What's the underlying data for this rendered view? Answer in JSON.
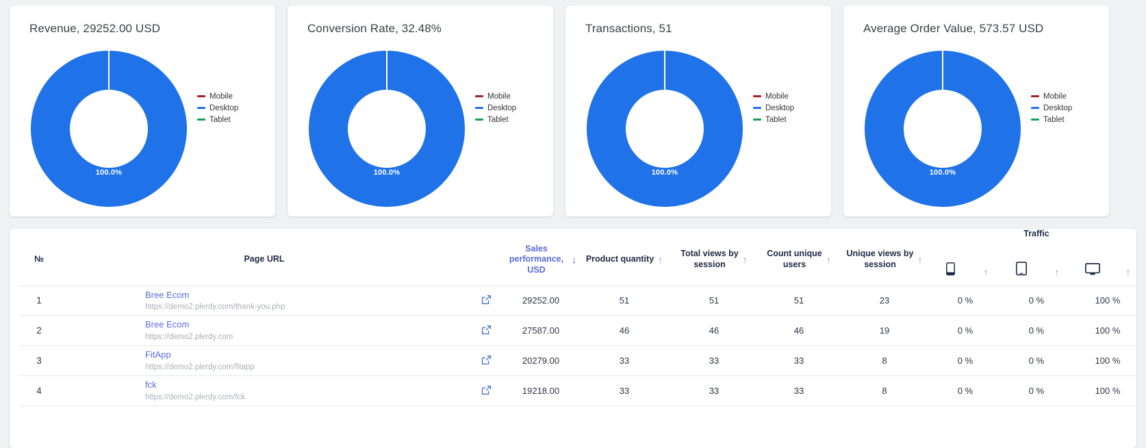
{
  "cards": [
    {
      "title": "Revenue, 29252.00 USD",
      "center_label": "100.0%",
      "legend": [
        {
          "label": "Mobile",
          "color": "#a32020"
        },
        {
          "label": "Desktop",
          "color": "#1f72e8"
        },
        {
          "label": "Tablet",
          "color": "#13a052"
        }
      ]
    },
    {
      "title": "Conversion Rate, 32.48%",
      "center_label": "100.0%",
      "legend": [
        {
          "label": "Mobile",
          "color": "#a32020"
        },
        {
          "label": "Desktop",
          "color": "#1f72e8"
        },
        {
          "label": "Tablet",
          "color": "#13a052"
        }
      ]
    },
    {
      "title": "Transactions, 51",
      "center_label": "100.0%",
      "legend": [
        {
          "label": "Mobile",
          "color": "#a32020"
        },
        {
          "label": "Desktop",
          "color": "#1f72e8"
        },
        {
          "label": "Tablet",
          "color": "#13a052"
        }
      ]
    },
    {
      "title": "Average Order Value, 573.57 USD",
      "center_label": "100.0%",
      "legend": [
        {
          "label": "Mobile",
          "color": "#a32020"
        },
        {
          "label": "Desktop",
          "color": "#1f72e8"
        },
        {
          "label": "Tablet",
          "color": "#13a052"
        }
      ]
    }
  ],
  "chart_data": [
    {
      "type": "pie",
      "title": "Revenue, 29252.00 USD",
      "labels": [
        "Mobile",
        "Desktop",
        "Tablet"
      ],
      "values": [
        0.0,
        100.0,
        0.0
      ],
      "colors": [
        "#a32020",
        "#1f72e8",
        "#13a052"
      ],
      "data_labels": [
        "100.0%"
      ],
      "legend_position": "right",
      "donut": true
    },
    {
      "type": "pie",
      "title": "Conversion Rate, 32.48%",
      "labels": [
        "Mobile",
        "Desktop",
        "Tablet"
      ],
      "values": [
        0.0,
        100.0,
        0.0
      ],
      "colors": [
        "#a32020",
        "#1f72e8",
        "#13a052"
      ],
      "data_labels": [
        "100.0%"
      ],
      "legend_position": "right",
      "donut": true
    },
    {
      "type": "pie",
      "title": "Transactions, 51",
      "labels": [
        "Mobile",
        "Desktop",
        "Tablet"
      ],
      "values": [
        0.0,
        100.0,
        0.0
      ],
      "colors": [
        "#a32020",
        "#1f72e8",
        "#13a052"
      ],
      "data_labels": [
        "100.0%"
      ],
      "legend_position": "right",
      "donut": true
    },
    {
      "type": "pie",
      "title": "Average Order Value, 573.57 USD",
      "labels": [
        "Mobile",
        "Desktop",
        "Tablet"
      ],
      "values": [
        0.0,
        100.0,
        0.0
      ],
      "colors": [
        "#a32020",
        "#1f72e8",
        "#13a052"
      ],
      "data_labels": [
        "100.0%"
      ],
      "legend_position": "right",
      "donut": true
    }
  ],
  "table": {
    "group_header": "Traffic",
    "headers": {
      "no": "№",
      "page_url": "Page URL",
      "sales": "Sales performance, USD",
      "sales_line1": "Sales",
      "sales_line2": "performance, USD",
      "quantity": "Product quantity",
      "total_views_line1": "Total views by",
      "total_views_line2": "session",
      "unique_users_line1": "Count unique",
      "unique_users_line2": "users",
      "unique_views_line1": "Unique views by",
      "unique_views_line2": "session"
    },
    "sort": {
      "active_column": "Sales performance, USD",
      "active_direction": "desc",
      "asc_glyph": "↑",
      "desc_glyph": "↓"
    },
    "device_icons": [
      "mobile-icon",
      "tablet-icon",
      "desktop-icon"
    ],
    "rows": [
      {
        "no": "1",
        "title": "Bree Ecom",
        "url": "https://demo2.plerdy.com/thank-you.php",
        "sales": "29252.00",
        "quantity": "51",
        "total_views": "51",
        "unique_users": "51",
        "unique_views": "23",
        "mobile": "0 %",
        "tablet": "0 %",
        "desktop": "100 %"
      },
      {
        "no": "2",
        "title": "Bree Ecom",
        "url": "https://demo2.plerdy.com",
        "sales": "27587.00",
        "quantity": "46",
        "total_views": "46",
        "unique_users": "46",
        "unique_views": "19",
        "mobile": "0 %",
        "tablet": "0 %",
        "desktop": "100 %"
      },
      {
        "no": "3",
        "title": "FitApp",
        "url": "https://demo2.plerdy.com/fitapp",
        "sales": "20279.00",
        "quantity": "33",
        "total_views": "33",
        "unique_users": "33",
        "unique_views": "8",
        "mobile": "0 %",
        "tablet": "0 %",
        "desktop": "100 %"
      },
      {
        "no": "4",
        "title": "fck",
        "url": "https://demo2.plerdy.com/fck",
        "sales": "19218.00",
        "quantity": "33",
        "total_views": "33",
        "unique_users": "33",
        "unique_views": "8",
        "mobile": "0 %",
        "tablet": "0 %",
        "desktop": "100 %"
      }
    ]
  }
}
